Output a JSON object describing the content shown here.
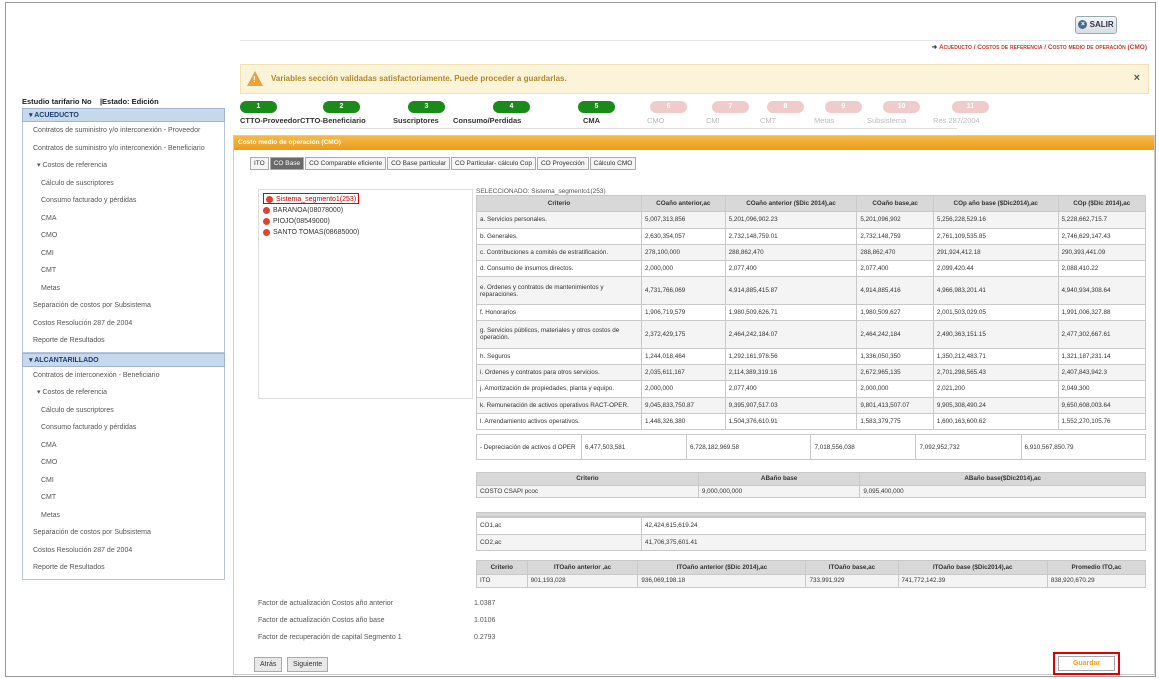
{
  "header": {
    "exit_label": "SALIR",
    "breadcrumb": "Acueducto / Costos de referencia / Costo medio de operación (CMO)"
  },
  "alert": {
    "message": "Variables sección validadas satisfactoriamente. Puede proceder a guardarlas.",
    "close": "×"
  },
  "study": {
    "label": "Estudio tarifario No",
    "state": "|Estado: Edición"
  },
  "sidebar": {
    "acueducto": {
      "title": "ACUEDUCTO",
      "items": [
        {
          "label": "Contratos de suministro y/o interconexión - Proveedor",
          "level": 1
        },
        {
          "label": "Contratos de suministro y/o interconexión - Beneficiario",
          "level": 1
        },
        {
          "label": "Costos de referencia",
          "level": 2
        },
        {
          "label": "Cálculo de suscriptores",
          "level": 3
        },
        {
          "label": "Consumo facturado y pérdidas",
          "level": 3
        },
        {
          "label": "CMA",
          "level": 3
        },
        {
          "label": "CMO",
          "level": 3
        },
        {
          "label": "CMI",
          "level": 3
        },
        {
          "label": "CMT",
          "level": 3
        },
        {
          "label": "Metas",
          "level": 3
        },
        {
          "label": "Separación de costos por Subsistema",
          "level": 1
        },
        {
          "label": "Costos Resolución 287 de 2004",
          "level": 1
        },
        {
          "label": "Reporte de Resultados",
          "level": 1
        }
      ]
    },
    "alcantarillado": {
      "title": "ALCANTARILLADO",
      "items": [
        {
          "label": "Contratos de interconexión - Beneficiario",
          "level": 1
        },
        {
          "label": "Costos de referencia",
          "level": 2
        },
        {
          "label": "Cálculo de suscriptores",
          "level": 3
        },
        {
          "label": "Consumo facturado y pérdidas",
          "level": 3
        },
        {
          "label": "CMA",
          "level": 3
        },
        {
          "label": "CMO",
          "level": 3
        },
        {
          "label": "CMI",
          "level": 3
        },
        {
          "label": "CMT",
          "level": 3
        },
        {
          "label": "Metas",
          "level": 3
        },
        {
          "label": "Separación de costos por Subsistema",
          "level": 1
        },
        {
          "label": "Costos Resolución 287 de 2004",
          "level": 1
        },
        {
          "label": "Reporte de Resultados",
          "level": 1
        }
      ]
    }
  },
  "steps": [
    {
      "num": "1",
      "label": "CTTO-Proveedor",
      "enabled": true
    },
    {
      "num": "2",
      "label": "CTTO-Beneficiario",
      "enabled": true
    },
    {
      "num": "3",
      "label": "Suscriptores",
      "enabled": true
    },
    {
      "num": "4",
      "label": "Consumo/Perdidas",
      "enabled": true
    },
    {
      "num": "5",
      "label": "CMA",
      "enabled": true
    },
    {
      "num": "6",
      "label": "CMO",
      "enabled": false
    },
    {
      "num": "7",
      "label": "CMI",
      "enabled": false
    },
    {
      "num": "8",
      "label": "CMT",
      "enabled": false
    },
    {
      "num": "9",
      "label": "Metas",
      "enabled": false
    },
    {
      "num": "10",
      "label": "Subsistema",
      "enabled": false
    },
    {
      "num": "11",
      "label": "Res 287/2004",
      "enabled": false
    }
  ],
  "panel": {
    "title": "Costo medio de operación (CMO)"
  },
  "tabs": [
    "ITO",
    "CO Base",
    "CO Comparable eficiente",
    "CO Base particular",
    "CO Particular- cálculo Cop",
    "CO Proyección",
    "Cálculo CMO"
  ],
  "tree": [
    {
      "label": "Sistema_segmento1(253)",
      "selected": true
    },
    {
      "label": "BARANOA(08078000)",
      "selected": false
    },
    {
      "label": "PIOJO(08549000)",
      "selected": false
    },
    {
      "label": "SANTO TOMAS(08685000)",
      "selected": false
    }
  ],
  "selected_label": "SELECCIONADO: Sistema_segmento1(253)",
  "main_table": {
    "headers": [
      "Criterio",
      "COaño anterior,ac",
      "COaño anterior ($Dic 2014),ac",
      "COaño base,ac",
      "COp año base ($Dic2014),ac",
      "COp ($Dic 2014),ac"
    ],
    "rows": [
      [
        "a. Servicios personales.",
        "5,007,313,856",
        "5,201,096,902.23",
        "5,201,096,902",
        "5,256,228,529.16",
        "5,228,662,715.7"
      ],
      [
        "b. Generales.",
        "2,630,354,057",
        "2,732,148,759.01",
        "2,732,148,759",
        "2,761,109,535.85",
        "2,746,629,147.43"
      ],
      [
        "c. Contribuciones a comités de estratificación.",
        "278,100,000",
        "288,862,470",
        "288,862,470",
        "291,924,412.18",
        "290,393,441.09"
      ],
      [
        "d. Consumo de insumos directos.",
        "2,000,000",
        "2,077,400",
        "2,077,400",
        "2,099,420.44",
        "2,088,410.22"
      ],
      [
        "e. Ordenes y contratos de mantenimientos y reparaciones.",
        "4,731,766,069",
        "4,914,885,415.87",
        "4,914,885,416",
        "4,966,983,201.41",
        "4,940,934,308.64"
      ],
      [
        "f. Honorarios",
        "1,906,719,579",
        "1,980,509,626.71",
        "1,980,509,627",
        "2,001,503,029.05",
        "1,991,006,327.88"
      ],
      [
        "g. Servicios públicos, materiales y otros costos de operación.",
        "2,372,429,175",
        "2,464,242,184.07",
        "2,464,242,184",
        "2,490,363,151.15",
        "2,477,302,667.61"
      ],
      [
        "h. Seguros",
        "1,244,018,464",
        "1,292,161,978.56",
        "1,336,050,350",
        "1,350,212,483.71",
        "1,321,187,231.14"
      ],
      [
        "i. Ordenes y contratos para otros servicios.",
        "2,035,611,167",
        "2,114,389,319.16",
        "2,672,965,135",
        "2,701,298,565.43",
        "2,407,843,942.3"
      ],
      [
        "j. Amortización de propiedades, planta y equipo.",
        "2,000,000",
        "2,077,400",
        "2,000,000",
        "2,021,200",
        "2,049,300"
      ],
      [
        "k. Remuneración de activos operativos RACT-OPER.",
        "9,045,833,750.87",
        "9,395,907,517.03",
        "9,801,413,507.07",
        "9,905,308,490.24",
        "9,650,608,003.64"
      ],
      [
        "l. Arrendamiento activos operativos.",
        "1,448,326,380",
        "1,504,376,610.91",
        "1,583,379,775",
        "1,600,163,600.62",
        "1,552,270,105.76"
      ]
    ],
    "dep_row": [
      "- Depreciación de activos d OPER",
      "6,477,503,581",
      "6,728,182,969.58",
      "7,018,556,038",
      "7,092,952,732",
      "6,910,567,850.79"
    ]
  },
  "ab_table": {
    "headers": [
      "Criterio",
      "ABaño base",
      "ABaño base($Dic2014),ac"
    ],
    "row": [
      "COSTO CSAPI pcoc",
      "9,000,000,000",
      "9,095,400,000"
    ]
  },
  "co_table": {
    "rows": [
      [
        "CO1,ac",
        "42,424,615,619.24"
      ],
      [
        "CO2,ac",
        "41,706,375,601.41"
      ]
    ]
  },
  "ito_table": {
    "headers": [
      "Criterio",
      "ITOaño anterior ,ac",
      "ITOaño anterior ($Dic 2014),ac",
      "ITOaño base,ac",
      "ITOaño base ($Dic2014),ac",
      "Promedio ITO,ac"
    ],
    "row": [
      "ITO",
      "901,193,028",
      "936,069,198.18",
      "733,991,929",
      "741,772,142.39",
      "838,920,670.29"
    ]
  },
  "factors": [
    {
      "label": "Factor de actualización Costos año anterior",
      "value": "1.0387"
    },
    {
      "label": "Factor de actualización Costos año base",
      "value": "1.0106"
    },
    {
      "label": "Factor de recuperación de capital Segmento 1",
      "value": "0.2793"
    }
  ],
  "buttons": {
    "back": "Atrás",
    "next": "Siguiente",
    "save": "Guardar"
  },
  "colors": {
    "accent_orange": "#f0a020",
    "step_green": "#1a8a1a",
    "highlight_red": "#e00000"
  }
}
